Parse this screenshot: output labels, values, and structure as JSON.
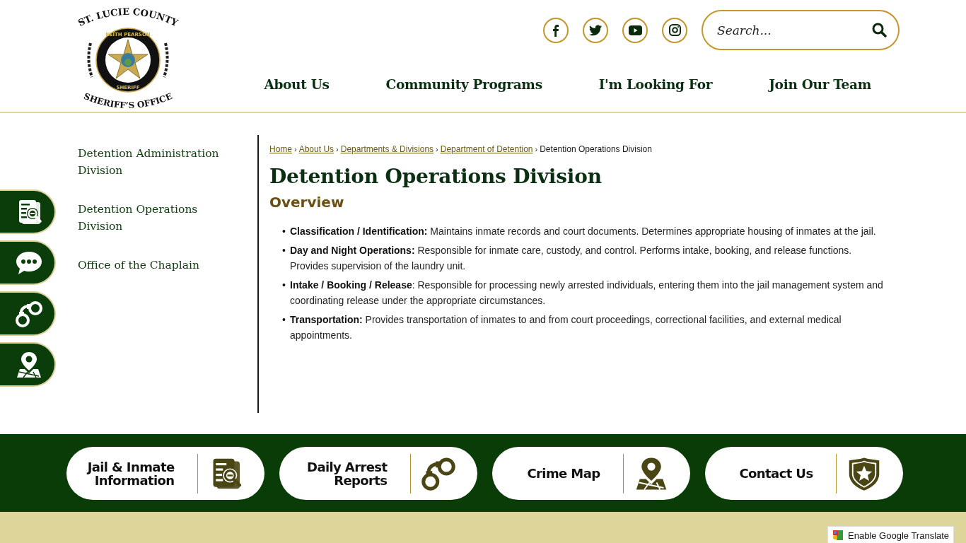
{
  "logo": {
    "texts": [
      "ST. LUCIE COUNTY",
      "KEITH PEARSON",
      "SHERIFF",
      "SHERIFF’S OFFICE"
    ]
  },
  "social": [
    {
      "kind": "facebook"
    },
    {
      "kind": "twitter"
    },
    {
      "kind": "youtube"
    },
    {
      "kind": "instagram"
    }
  ],
  "search": {
    "placeholder": "Search..."
  },
  "nav": [
    "About Us",
    "Community Programs",
    "I'm Looking For",
    "Join Our Team"
  ],
  "side_nav": [
    "Detention Administration Division",
    "Detention Operations Division",
    "Office of the Chaplain"
  ],
  "side_tabs": [
    {
      "kind": "document"
    },
    {
      "kind": "chat"
    },
    {
      "kind": "handcuffs"
    },
    {
      "kind": "map"
    }
  ],
  "breadcrumb": {
    "links": [
      {
        "label": "Home",
        "separator": "›"
      },
      {
        "label": "About Us",
        "separator": "›"
      },
      {
        "label": "Departments & Divisions",
        "separator": "›"
      },
      {
        "label": "Department of Detention",
        "separator": "›"
      }
    ],
    "current": "Detention Operations Division"
  },
  "title": "Detention Operations Division",
  "section_heading": "Overview",
  "items": [
    {
      "bullet": "•",
      "text": "**Classification / Identification:** Maintains inmate records and court documents. Determines appropriate housing of inmates at the jail."
    },
    {
      "bullet": "•",
      "text": "**Day and Night Operations:** Responsible for inmate care, custody, and control. Performs intake, booking, and release functions. Provides supervision of the laundry unit."
    },
    {
      "bullet": "•",
      "text": "**Intake / Booking / Release**: Responsible for processing newly arrested individuals, entering them into the jail management system and coordinating release under the appropriate circumstances."
    },
    {
      "bullet": "•",
      "text": "**Transportation:** Provides transportation of inmates to and from court proceedings, correctional facilities, and external medical appointments."
    }
  ],
  "quick_links": [
    {
      "label": "Jail & Inmate Information",
      "kind": "document"
    },
    {
      "label": "Daily Arrest Reports",
      "kind": "handcuffs"
    },
    {
      "label": "Crime Map",
      "kind": "map"
    },
    {
      "label": "Contact Us",
      "kind": "badge"
    }
  ],
  "translate": "Enable Google Translate"
}
